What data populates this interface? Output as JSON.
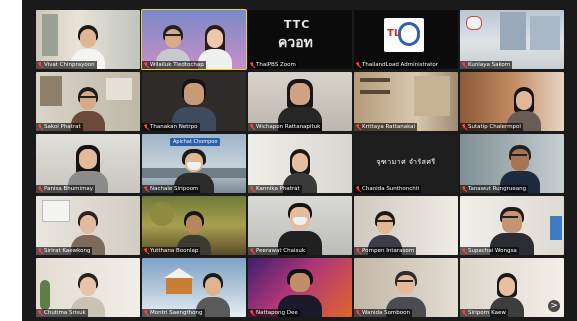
{
  "gallery": {
    "next_page_icon": "chevron-right-icon",
    "next_page_glyph": ">",
    "mic_icon": "microphone-muted-icon",
    "tiles": [
      {
        "name": "Vivat Chinprayoon",
        "muted": true
      },
      {
        "name": "Wilailuk Tiedtochap",
        "muted": true
      },
      {
        "name": "ThaiPBS Zoom",
        "muted": true
      },
      {
        "name": "ThailandLoad Administrator",
        "muted": true
      },
      {
        "name": "Kunlaya Sakorn",
        "muted": true
      },
      {
        "name": "Sakol Phatrat",
        "muted": true
      },
      {
        "name": "Thanakan Netrpo",
        "muted": true
      },
      {
        "name": "Wichapon Rattanapituk",
        "muted": true
      },
      {
        "name": "Krittaya Rattanakai",
        "muted": true
      },
      {
        "name": "Sutatip Chalermpol",
        "muted": true
      },
      {
        "name": "Panisa Bhumimay",
        "muted": true
      },
      {
        "name": "Nachale Siripoom",
        "muted": true,
        "tag": "Apichat Chompoo"
      },
      {
        "name": "Kannika Phatrat",
        "muted": true
      },
      {
        "name": "Chanida Sunthonchit",
        "muted": true,
        "caption": "จุฑามาศ จำรัสศรี"
      },
      {
        "name": "Tanawut Rungrueang",
        "muted": true
      },
      {
        "name": "Sirirat Kaewkong",
        "muted": true
      },
      {
        "name": "Yutthana Boonlap",
        "muted": true
      },
      {
        "name": "Peerawat Chaisuk",
        "muted": true
      },
      {
        "name": "Pornpen Intarasorn",
        "muted": true
      },
      {
        "name": "Supachai Wongsa",
        "muted": true
      },
      {
        "name": "Chutima Srisuk",
        "muted": true
      },
      {
        "name": "Montri Saengthong",
        "muted": true
      },
      {
        "name": "Nattapong Dee",
        "muted": true
      },
      {
        "name": "Wanida Somboon",
        "muted": true
      },
      {
        "name": "Siriporn Kaew",
        "muted": true
      }
    ],
    "logos": {
      "thaipbs_mark": "TTC",
      "thaipbs_word": "ควอท",
      "tl_mark": "TL"
    }
  }
}
